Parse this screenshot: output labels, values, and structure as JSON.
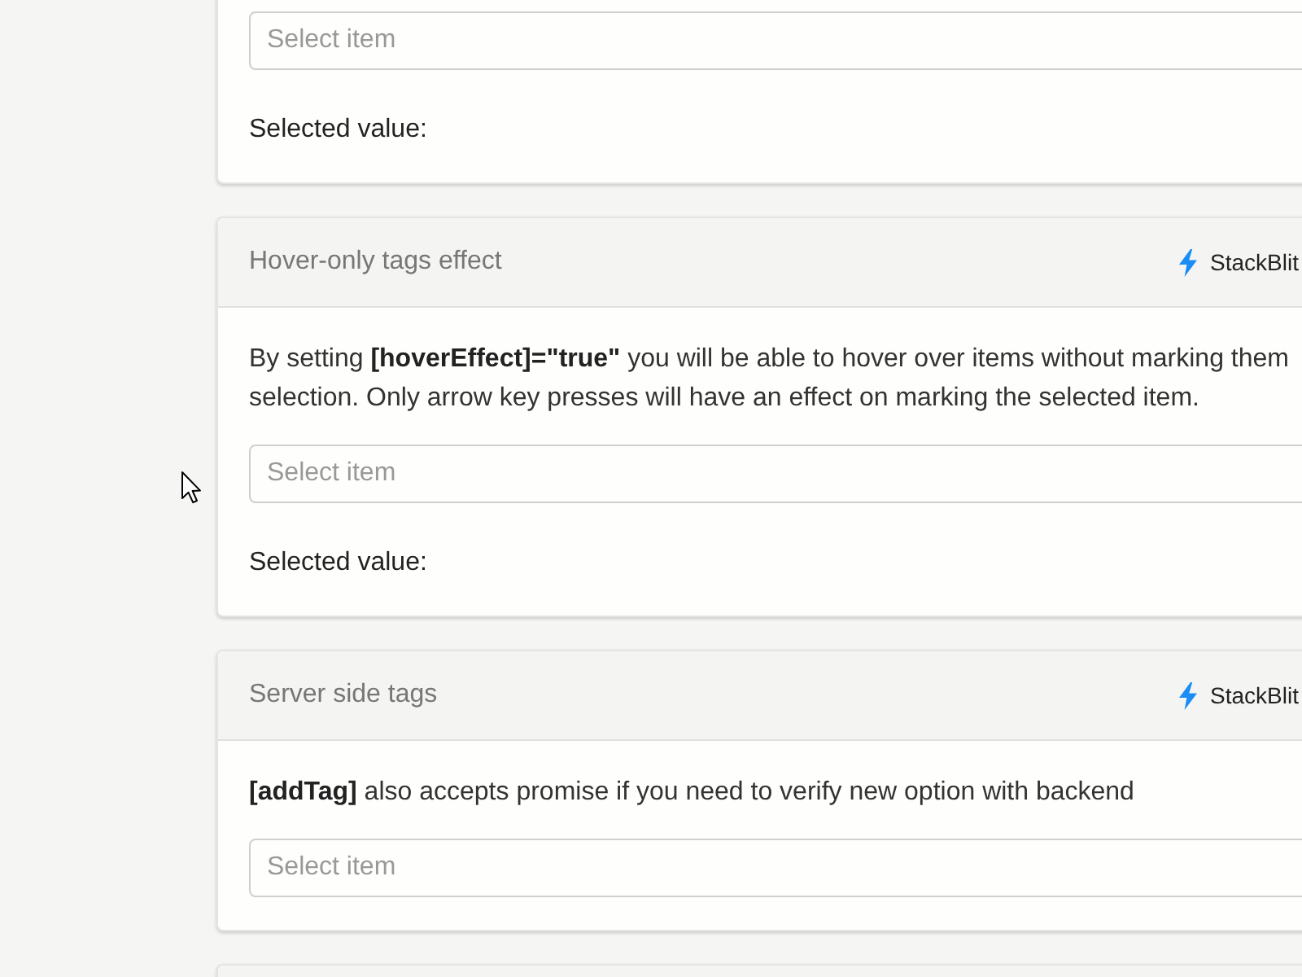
{
  "cards": [
    {
      "select": {
        "placeholder": "Select item"
      },
      "result_label": "Selected value:"
    },
    {
      "title": "Hover-only tags effect",
      "link": "StackBlit",
      "description_lines": [
        "By setting **[hoverEffect]=\"true\"** you will be able to hover over items without marking them",
        "selection. Only arrow key presses will have an effect on marking the selected item."
      ],
      "select": {
        "placeholder": "Select item"
      },
      "result_label": "Selected value:"
    },
    {
      "title": "Server side tags",
      "link": "StackBlit",
      "description_lines": [
        "**[addTag]** also accepts promise if you need to verify new option with backend"
      ],
      "select": {
        "placeholder": "Select item"
      }
    }
  ]
}
